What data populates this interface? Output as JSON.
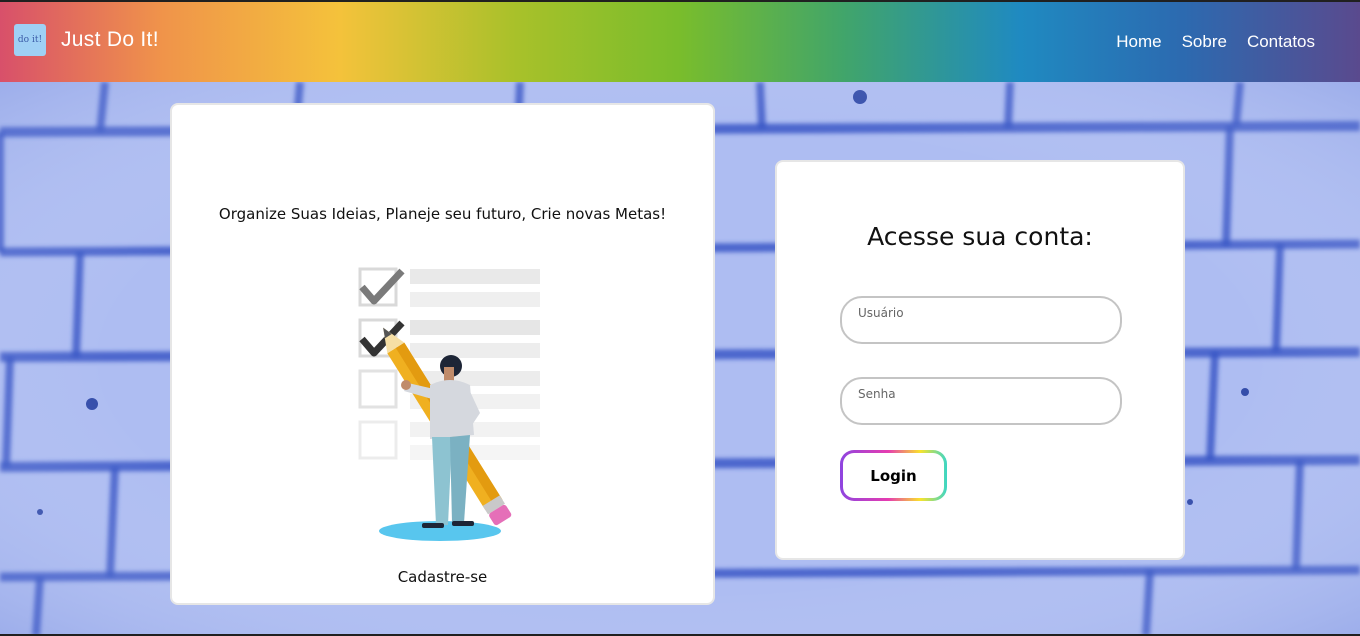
{
  "navbar": {
    "logo_text": "do it!",
    "brand": "Just Do It!",
    "links": [
      "Home",
      "Sobre",
      "Contatos"
    ]
  },
  "left_card": {
    "tagline": "Organize Suas Ideias, Planeje seu futuro, Crie novas Metas!",
    "illustration": "checklist-person-pencil-illustration",
    "signup_label": "Cadastre-se"
  },
  "login_card": {
    "title": "Acesse sua conta:",
    "username_placeholder": "Usuário",
    "password_placeholder": "Senha",
    "login_label": "Login"
  },
  "colors": {
    "wall": "#aebdf2",
    "brick_lines": "#2f4fbf",
    "card_bg": "#ffffff"
  }
}
